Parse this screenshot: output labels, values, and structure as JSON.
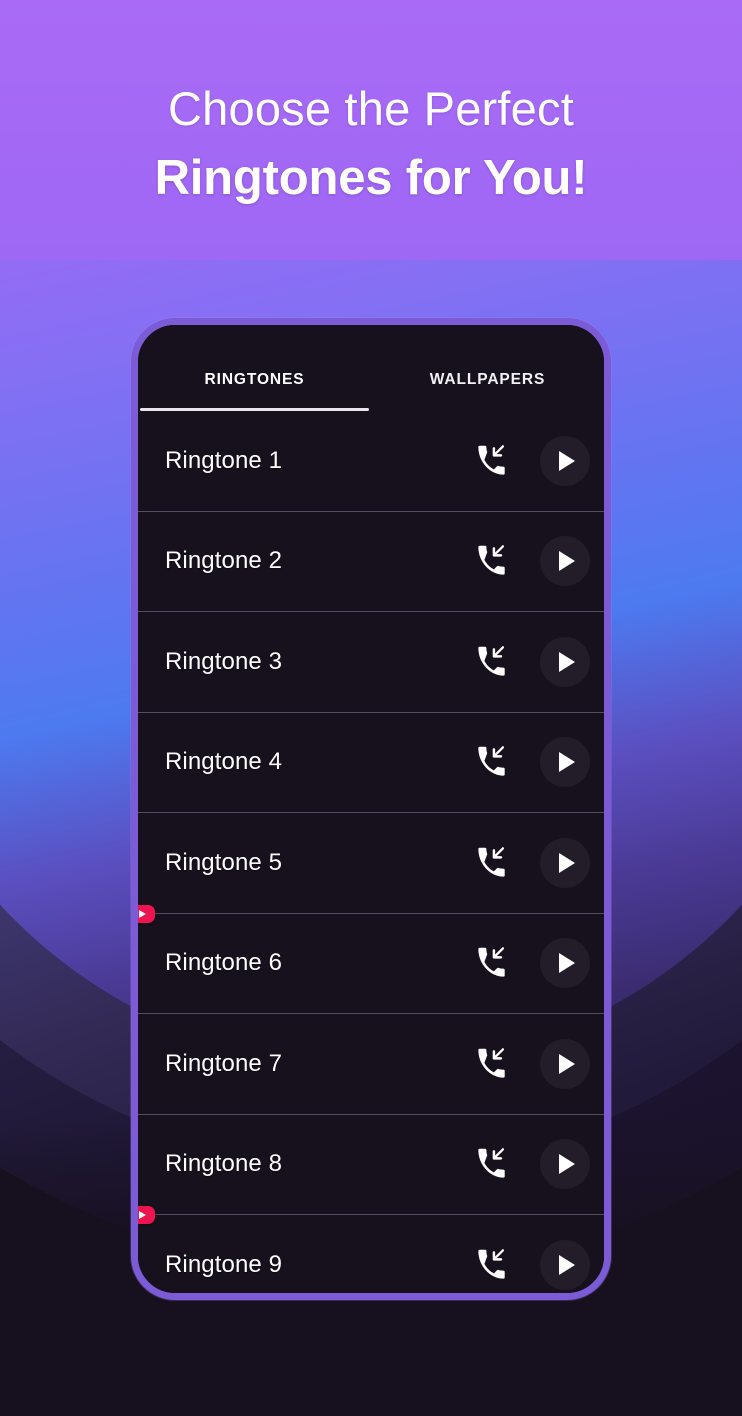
{
  "headline": {
    "line1": "Choose the Perfect",
    "line2": "Ringtones for You!"
  },
  "colors": {
    "gradient_top": "#A96BF5",
    "gradient_mid": "#4D7AF0",
    "page_background": "#17101F",
    "phone_frame": "#7B5BD6",
    "phone_screen": "#17101D",
    "row_divider": "#564B63",
    "accent_badge_red": "#ED1450",
    "text_primary": "#FFFFFF"
  },
  "phone": {
    "tabs": [
      {
        "label": "RINGTONES",
        "active": true
      },
      {
        "label": "WALLPAPERS",
        "active": false
      }
    ],
    "rows": [
      {
        "label": "Ringtone 1",
        "call_icon": "incoming-call-icon",
        "play_icon": "play-icon",
        "ad_badge": false
      },
      {
        "label": "Ringtone 2",
        "call_icon": "incoming-call-icon",
        "play_icon": "play-icon",
        "ad_badge": false
      },
      {
        "label": "Ringtone 3",
        "call_icon": "incoming-call-icon",
        "play_icon": "play-icon",
        "ad_badge": false
      },
      {
        "label": "Ringtone 4",
        "call_icon": "incoming-call-icon",
        "play_icon": "play-icon",
        "ad_badge": false
      },
      {
        "label": "Ringtone 5",
        "call_icon": "incoming-call-icon",
        "play_icon": "play-icon",
        "ad_badge": false
      },
      {
        "label": "Ringtone 6",
        "call_icon": "incoming-call-icon",
        "play_icon": "play-icon",
        "ad_badge": true
      },
      {
        "label": "Ringtone 7",
        "call_icon": "incoming-call-icon",
        "play_icon": "play-icon",
        "ad_badge": false
      },
      {
        "label": "Ringtone 8",
        "call_icon": "incoming-call-icon",
        "play_icon": "play-icon",
        "ad_badge": false
      },
      {
        "label": "Ringtone 9",
        "call_icon": "incoming-call-icon",
        "play_icon": "play-icon",
        "ad_badge": true
      }
    ]
  }
}
